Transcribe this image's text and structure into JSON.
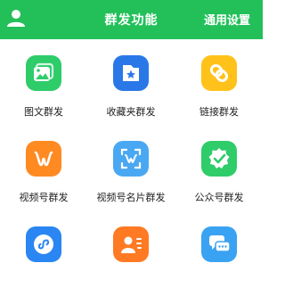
{
  "header": {
    "title": "群发功能",
    "settings_label": "通用设置",
    "background": "#23c05a"
  },
  "items": [
    {
      "label": "图文群发",
      "icon": "image-text-icon",
      "color": "#2fcc6a"
    },
    {
      "label": "收藏夹群发",
      "icon": "favorites-folder-icon",
      "color": "#2a78e8"
    },
    {
      "label": "链接群发",
      "icon": "link-icon",
      "color": "#ffc21a"
    },
    {
      "label": "视频号群发",
      "icon": "channels-icon",
      "color": "#ff8a22"
    },
    {
      "label": "视频号名片群发",
      "icon": "channels-card-icon",
      "color": "#4aa8f2"
    },
    {
      "label": "公众号群发",
      "icon": "official-account-icon",
      "color": "#2fcc6a"
    },
    {
      "label": "",
      "icon": "mini-program-icon",
      "color": "#2a86f2"
    },
    {
      "label": "",
      "icon": "contact-card-icon",
      "color": "#ff7a22"
    },
    {
      "label": "",
      "icon": "chat-bubbles-icon",
      "color": "#3aa2f2"
    }
  ]
}
